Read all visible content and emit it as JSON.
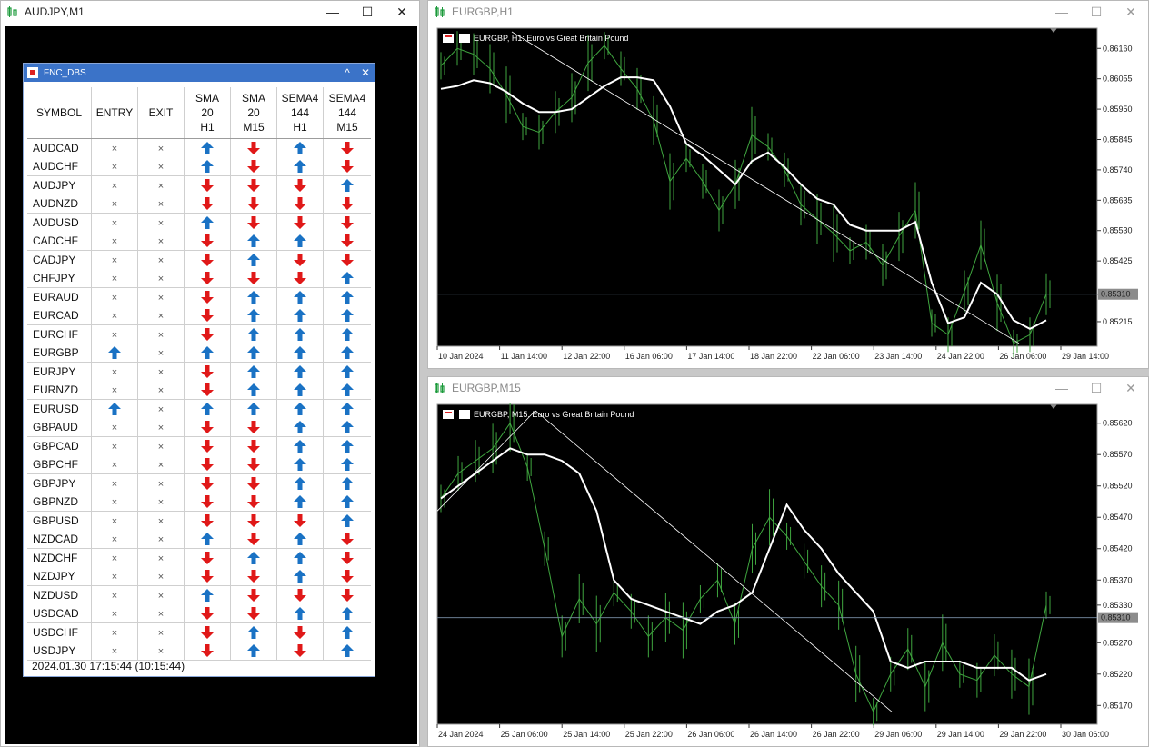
{
  "windows": {
    "left": {
      "title": "AUDJPY,M1"
    },
    "top_right": {
      "title": "EURGBP,H1",
      "chart_label": "EURGBP, H1:  Euro vs Great Britain Pound",
      "current_price": "0.85310"
    },
    "bottom_right": {
      "title": "EURGBP,M15",
      "chart_label": "EURGBP, M15:  Euro vs Great Britain Pound",
      "current_price": "0.85310"
    }
  },
  "window_buttons": {
    "minimize": "—",
    "maximize": "☐",
    "close": "✕"
  },
  "panel": {
    "title": "FNC_DBS",
    "collapse_glyph": "^",
    "close_glyph": "✕",
    "headers": [
      [
        "SYMBOL"
      ],
      [
        "ENTRY"
      ],
      [
        "EXIT"
      ],
      [
        "SMA",
        "20",
        "H1"
      ],
      [
        "SMA",
        "20",
        "M15"
      ],
      [
        "SEMA4",
        "144",
        "H1"
      ],
      [
        "SEMA4",
        "144",
        "M15"
      ]
    ],
    "no_signal_glyph": "×",
    "colors": {
      "up": "#1a72c4",
      "down": "#e01818"
    },
    "rows": [
      {
        "symbol": "AUDCAD",
        "entry": "none",
        "exit": "none",
        "sma20_h1": "up",
        "sma20_m15": "down",
        "sema144_h1": "up",
        "sema144_m15": "down"
      },
      {
        "symbol": "AUDCHF",
        "entry": "none",
        "exit": "none",
        "sma20_h1": "up",
        "sma20_m15": "down",
        "sema144_h1": "up",
        "sema144_m15": "down"
      },
      {
        "symbol": "AUDJPY",
        "entry": "none",
        "exit": "none",
        "sma20_h1": "down",
        "sma20_m15": "down",
        "sema144_h1": "down",
        "sema144_m15": "up"
      },
      {
        "symbol": "AUDNZD",
        "entry": "none",
        "exit": "none",
        "sma20_h1": "down",
        "sma20_m15": "down",
        "sema144_h1": "down",
        "sema144_m15": "down"
      },
      {
        "symbol": "AUDUSD",
        "entry": "none",
        "exit": "none",
        "sma20_h1": "up",
        "sma20_m15": "down",
        "sema144_h1": "down",
        "sema144_m15": "down"
      },
      {
        "symbol": "CADCHF",
        "entry": "none",
        "exit": "none",
        "sma20_h1": "down",
        "sma20_m15": "up",
        "sema144_h1": "up",
        "sema144_m15": "down"
      },
      {
        "symbol": "CADJPY",
        "entry": "none",
        "exit": "none",
        "sma20_h1": "down",
        "sma20_m15": "up",
        "sema144_h1": "down",
        "sema144_m15": "down"
      },
      {
        "symbol": "CHFJPY",
        "entry": "none",
        "exit": "none",
        "sma20_h1": "down",
        "sma20_m15": "down",
        "sema144_h1": "down",
        "sema144_m15": "up"
      },
      {
        "symbol": "EURAUD",
        "entry": "none",
        "exit": "none",
        "sma20_h1": "down",
        "sma20_m15": "up",
        "sema144_h1": "up",
        "sema144_m15": "up"
      },
      {
        "symbol": "EURCAD",
        "entry": "none",
        "exit": "none",
        "sma20_h1": "down",
        "sma20_m15": "up",
        "sema144_h1": "up",
        "sema144_m15": "up"
      },
      {
        "symbol": "EURCHF",
        "entry": "none",
        "exit": "none",
        "sma20_h1": "down",
        "sma20_m15": "up",
        "sema144_h1": "up",
        "sema144_m15": "up"
      },
      {
        "symbol": "EURGBP",
        "entry": "up",
        "exit": "none",
        "sma20_h1": "up",
        "sma20_m15": "up",
        "sema144_h1": "up",
        "sema144_m15": "up"
      },
      {
        "symbol": "EURJPY",
        "entry": "none",
        "exit": "none",
        "sma20_h1": "down",
        "sma20_m15": "up",
        "sema144_h1": "up",
        "sema144_m15": "up"
      },
      {
        "symbol": "EURNZD",
        "entry": "none",
        "exit": "none",
        "sma20_h1": "down",
        "sma20_m15": "up",
        "sema144_h1": "up",
        "sema144_m15": "up"
      },
      {
        "symbol": "EURUSD",
        "entry": "up",
        "exit": "none",
        "sma20_h1": "up",
        "sma20_m15": "up",
        "sema144_h1": "up",
        "sema144_m15": "up"
      },
      {
        "symbol": "GBPAUD",
        "entry": "none",
        "exit": "none",
        "sma20_h1": "down",
        "sma20_m15": "down",
        "sema144_h1": "up",
        "sema144_m15": "up"
      },
      {
        "symbol": "GBPCAD",
        "entry": "none",
        "exit": "none",
        "sma20_h1": "down",
        "sma20_m15": "down",
        "sema144_h1": "up",
        "sema144_m15": "up"
      },
      {
        "symbol": "GBPCHF",
        "entry": "none",
        "exit": "none",
        "sma20_h1": "down",
        "sma20_m15": "down",
        "sema144_h1": "up",
        "sema144_m15": "up"
      },
      {
        "symbol": "GBPJPY",
        "entry": "none",
        "exit": "none",
        "sma20_h1": "down",
        "sma20_m15": "down",
        "sema144_h1": "up",
        "sema144_m15": "up"
      },
      {
        "symbol": "GBPNZD",
        "entry": "none",
        "exit": "none",
        "sma20_h1": "down",
        "sma20_m15": "down",
        "sema144_h1": "up",
        "sema144_m15": "up"
      },
      {
        "symbol": "GBPUSD",
        "entry": "none",
        "exit": "none",
        "sma20_h1": "down",
        "sma20_m15": "down",
        "sema144_h1": "down",
        "sema144_m15": "up"
      },
      {
        "symbol": "NZDCAD",
        "entry": "none",
        "exit": "none",
        "sma20_h1": "up",
        "sma20_m15": "down",
        "sema144_h1": "up",
        "sema144_m15": "down"
      },
      {
        "symbol": "NZDCHF",
        "entry": "none",
        "exit": "none",
        "sma20_h1": "down",
        "sma20_m15": "up",
        "sema144_h1": "up",
        "sema144_m15": "down"
      },
      {
        "symbol": "NZDJPY",
        "entry": "none",
        "exit": "none",
        "sma20_h1": "down",
        "sma20_m15": "down",
        "sema144_h1": "up",
        "sema144_m15": "down"
      },
      {
        "symbol": "NZDUSD",
        "entry": "none",
        "exit": "none",
        "sma20_h1": "up",
        "sma20_m15": "down",
        "sema144_h1": "down",
        "sema144_m15": "down"
      },
      {
        "symbol": "USDCAD",
        "entry": "none",
        "exit": "none",
        "sma20_h1": "down",
        "sma20_m15": "down",
        "sema144_h1": "up",
        "sema144_m15": "up"
      },
      {
        "symbol": "USDCHF",
        "entry": "none",
        "exit": "none",
        "sma20_h1": "down",
        "sma20_m15": "up",
        "sema144_h1": "down",
        "sema144_m15": "up"
      },
      {
        "symbol": "USDJPY",
        "entry": "none",
        "exit": "none",
        "sma20_h1": "down",
        "sma20_m15": "up",
        "sema144_h1": "down",
        "sema144_m15": "up"
      }
    ],
    "footer": "2024.01.30 17:15:44 (10:15:44)"
  },
  "chart_data": [
    {
      "type": "line",
      "title": "EURGBP, H1:  Euro vs Great Britain Pound",
      "x_ticks": [
        "10 Jan 2024",
        "11 Jan 14:00",
        "12 Jan 22:00",
        "16 Jan 06:00",
        "17 Jan 14:00",
        "18 Jan 22:00",
        "22 Jan 06:00",
        "23 Jan 14:00",
        "24 Jan 22:00",
        "26 Jan 06:00",
        "29 Jan 14:00"
      ],
      "y_ticks": [
        0.8616,
        0.86055,
        0.8595,
        0.85845,
        0.8574,
        0.85635,
        0.8553,
        0.85425,
        0.8531,
        0.85215
      ],
      "ylim": [
        0.8513,
        0.8623
      ],
      "current_price": 0.8531,
      "series": [
        {
          "values": [
            0.8602,
            0.8603,
            0.8605,
            0.8604,
            0.8601,
            0.8597,
            0.8594,
            0.8594,
            0.8595,
            0.8599,
            0.8603,
            0.8606,
            0.8606,
            0.8605,
            0.8596,
            0.8583,
            0.8579,
            0.8574,
            0.8569,
            0.8577,
            0.858,
            0.8575,
            0.8569,
            0.8564,
            0.8562,
            0.8555,
            0.8553,
            0.8553,
            0.8553,
            0.8556,
            0.8535,
            0.8521,
            0.8523,
            0.8535,
            0.8531,
            0.8522,
            0.8519,
            0.8522
          ]
        },
        {
          "values": [
            0.861,
            0.8616,
            0.8614,
            0.8609,
            0.86,
            0.8589,
            0.8587,
            0.8594,
            0.8599,
            0.8611,
            0.8617,
            0.8609,
            0.8602,
            0.8591,
            0.857,
            0.8578,
            0.857,
            0.856,
            0.8569,
            0.8586,
            0.8582,
            0.8574,
            0.8562,
            0.8557,
            0.8552,
            0.8546,
            0.8549,
            0.8541,
            0.8551,
            0.856,
            0.8521,
            0.8517,
            0.8532,
            0.8548,
            0.8528,
            0.8514,
            0.8517,
            0.8531
          ]
        }
      ]
    },
    {
      "type": "line",
      "title": "EURGBP, M15:  Euro vs Great Britain Pound",
      "x_ticks": [
        "24 Jan 2024",
        "25 Jan 06:00",
        "25 Jan 14:00",
        "25 Jan 22:00",
        "26 Jan 06:00",
        "26 Jan 14:00",
        "26 Jan 22:00",
        "29 Jan 06:00",
        "29 Jan 14:00",
        "29 Jan 22:00",
        "30 Jan 06:00"
      ],
      "y_ticks": [
        0.8562,
        0.8557,
        0.8552,
        0.8547,
        0.8542,
        0.8537,
        0.8533,
        0.8527,
        0.8522,
        0.8517
      ],
      "ylim": [
        0.8514,
        0.8565
      ],
      "current_price": 0.8531,
      "series": [
        {
          "values": [
            0.855,
            0.8552,
            0.8554,
            0.8556,
            0.8558,
            0.8557,
            0.8557,
            0.8556,
            0.8554,
            0.8548,
            0.8537,
            0.8534,
            0.8533,
            0.8532,
            0.8531,
            0.853,
            0.8532,
            0.8533,
            0.8535,
            0.8542,
            0.8549,
            0.8545,
            0.8542,
            0.8538,
            0.8535,
            0.8532,
            0.8524,
            0.8523,
            0.8524,
            0.8524,
            0.8524,
            0.8523,
            0.8523,
            0.8523,
            0.8521,
            0.8522
          ]
        },
        {
          "values": [
            0.855,
            0.8554,
            0.8556,
            0.8558,
            0.8562,
            0.8555,
            0.8542,
            0.8528,
            0.8534,
            0.853,
            0.8535,
            0.8532,
            0.8528,
            0.8531,
            0.8529,
            0.8534,
            0.8537,
            0.853,
            0.8542,
            0.8547,
            0.8544,
            0.854,
            0.8536,
            0.8533,
            0.8522,
            0.8516,
            0.8522,
            0.8526,
            0.852,
            0.8527,
            0.8522,
            0.8521,
            0.8525,
            0.8522,
            0.852,
            0.8533
          ]
        }
      ]
    }
  ]
}
